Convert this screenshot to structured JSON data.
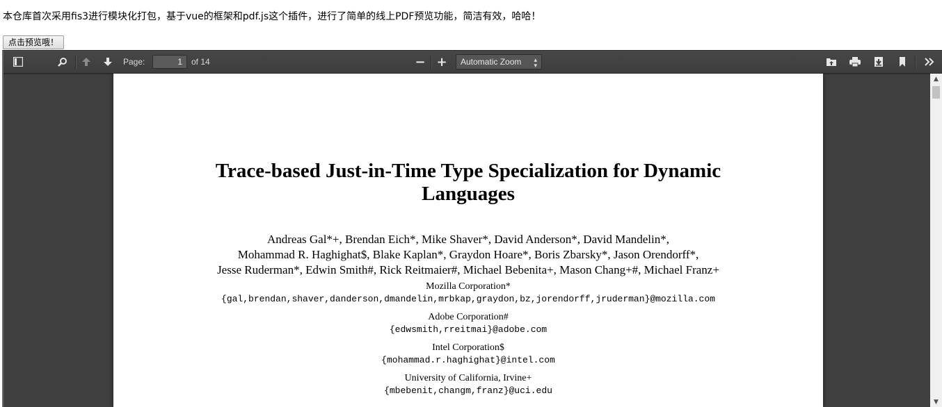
{
  "intro_text": "本仓库首次采用fis3进行模块化打包，基于vue的框架和pdf.js这个插件，进行了简单的线上PDF预览功能，简洁有效，哈哈！",
  "preview_button": "点击预览哦！",
  "toolbar": {
    "page_label": "Page:",
    "page_value": "1",
    "page_total": "of 14",
    "zoom_value": "Automatic Zoom",
    "zoom_minus": "−",
    "zoom_plus": "+"
  },
  "document": {
    "title_line1": "Trace-based Just-in-Time Type Specialization for Dynamic",
    "title_line2": "Languages",
    "authors_line1": "Andreas Gal*+, Brendan Eich*, Mike Shaver*, David Anderson*, David Mandelin*,",
    "authors_line2": "Mohammad R. Haghighat$, Blake Kaplan*, Graydon Hoare*, Boris Zbarsky*, Jason Orendorff*,",
    "authors_line3": "Jesse Ruderman*, Edwin Smith#, Rick Reitmaier#, Michael Bebenita+, Mason Chang+#, Michael Franz+",
    "affiliations": [
      {
        "name": "Mozilla Corporation*",
        "email": "{gal,brendan,shaver,danderson,dmandelin,mrbkap,graydon,bz,jorendorff,jruderman}@mozilla.com"
      },
      {
        "name": "Adobe Corporation#",
        "email": "{edwsmith,rreitmai}@adobe.com"
      },
      {
        "name": "Intel Corporation$",
        "email": "{mohammad.r.haghighat}@intel.com"
      },
      {
        "name": "University of California, Irvine+",
        "email": "{mbebenit,changm,franz}@uci.edu"
      }
    ]
  },
  "icons": [
    "sidebar-toggle-icon",
    "search-icon",
    "previous-page-icon",
    "next-page-icon",
    "open-file-icon",
    "print-icon",
    "download-icon",
    "bookmark-icon",
    "tools-icon"
  ]
}
